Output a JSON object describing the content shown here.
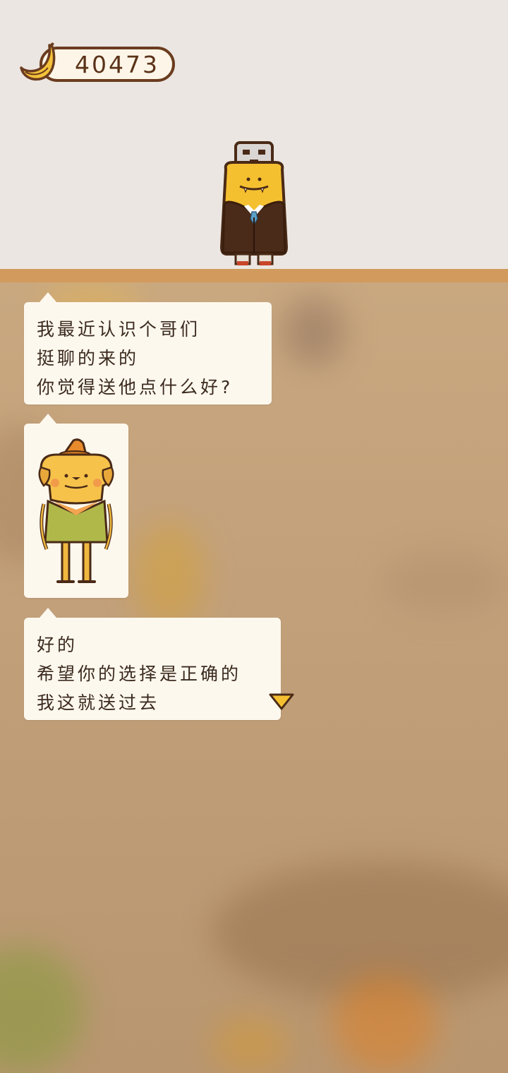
{
  "hud": {
    "banana_count": "40473",
    "currency_icon": "banana-icon"
  },
  "character": {
    "icon": "usb-head-suit-character"
  },
  "dialogue": [
    {
      "speaker": "player",
      "text": "我最近认识个哥们\n挺聊的来的\n你觉得送他点什么好?"
    },
    {
      "speaker": "player",
      "image": "gift-dog-character"
    },
    {
      "speaker": "npc",
      "text": "好的\n希望你的选择是正确的\n我这就送过去"
    }
  ],
  "continue_icon": "triangle-down-icon",
  "colors": {
    "top_bg": "#ebe6e1",
    "shelf": "#d29a5c",
    "bubble_bg": "#fdf8ee",
    "accent_yellow": "#f5c030",
    "text_dark": "#3b2a1e"
  }
}
